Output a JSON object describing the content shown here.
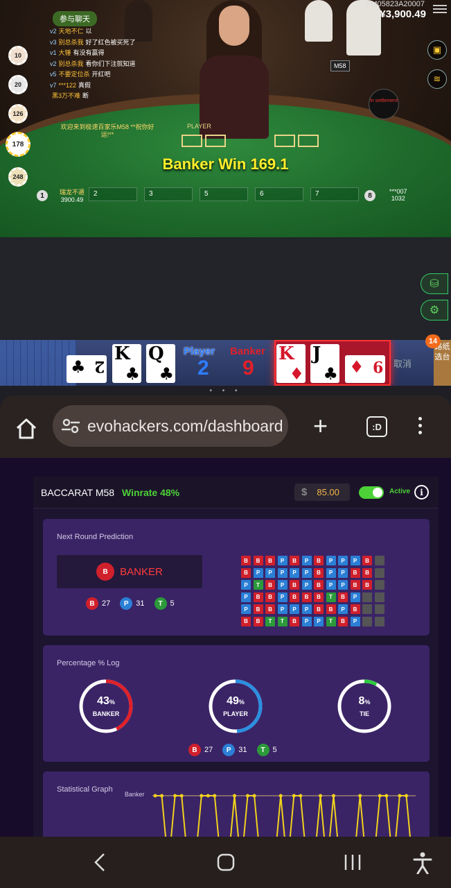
{
  "video": {
    "table_id": "GM05823A20007",
    "balance": "¥3,900.49",
    "chat_tab": "参与聊天",
    "chat": [
      {
        "lvl": "v2",
        "name": "天地不仁",
        "msg": "以"
      },
      {
        "lvl": "v3",
        "name": "别总杀我",
        "msg": "好了红色被买死了"
      },
      {
        "lvl": "v1",
        "name": "大锤",
        "msg": "有没有赢得"
      },
      {
        "lvl": "v2",
        "name": "别总杀我",
        "msg": "看你们下注就知道"
      },
      {
        "lvl": "v5",
        "name": "不要定位杀",
        "msg": "开红吧"
      },
      {
        "lvl": "v7",
        "name": "***122",
        "msg": "真假"
      },
      {
        "lvl": "",
        "name": "黑3万不难",
        "msg": "断"
      }
    ],
    "welcome": "欢迎来到极速百家乐M58 **祝你好运!**",
    "chips": [
      "10",
      "20",
      "126",
      "178",
      "248"
    ],
    "result_banner": "Banker Win 169.1",
    "shoe_label": "M58",
    "settlement": "In settlement",
    "player_label": "PLAYER",
    "seat_left_name": "瑞龙不遁",
    "seat_left_balance": "3900.49",
    "seat_left_num": "1",
    "seat_right_num": "8",
    "seat_right_name": "***007",
    "seat_right_balance": "1032",
    "seat_boxes": [
      "2",
      "3",
      "5",
      "6",
      "7"
    ]
  },
  "cards_strip": {
    "player_cards": [
      {
        "rank": "2",
        "suit": "♣",
        "color": "black",
        "side": true
      },
      {
        "rank": "K",
        "suit": "♣",
        "color": "black",
        "side": false
      },
      {
        "rank": "Q",
        "suit": "♣",
        "color": "black",
        "side": false
      }
    ],
    "banker_cards": [
      {
        "rank": "K",
        "suit": "♦",
        "color": "red",
        "side": false
      },
      {
        "rank": "J",
        "suit": "♣",
        "color": "black",
        "side": false
      },
      {
        "rank": "9",
        "suit": "♦",
        "color": "red",
        "side": true
      }
    ],
    "player_label": "Player",
    "player_score": "2",
    "banker_label": "Banker",
    "banker_score": "9",
    "cancel_text": "取消",
    "road_button": "路纸选台",
    "badge": "14",
    "page_dots": "• • •"
  },
  "browser": {
    "url": "evohackers.com/dashboard",
    "tabs_label": ":D"
  },
  "dashboard": {
    "title": "BACCARAT M58",
    "title_overlap": "M58",
    "winrate": "Winrate 48%",
    "amount": "85.00",
    "currency_symbol": "$",
    "active_label": "Active",
    "info_symbol": "i",
    "prediction": {
      "title": "Next Round Prediction",
      "badge": "B",
      "label": "BANKER",
      "counts": [
        {
          "letter": "B",
          "value": "27",
          "kind": "b"
        },
        {
          "letter": "P",
          "value": "31",
          "kind": "p"
        },
        {
          "letter": "T",
          "value": "5",
          "kind": "t"
        }
      ],
      "grid": [
        [
          "B",
          "B",
          "B",
          "P",
          "B",
          "P",
          "B",
          "P",
          "P",
          "P",
          "B",
          ""
        ],
        [
          "B",
          "P",
          "P",
          "P",
          "P",
          "P",
          "B",
          "P",
          "P",
          "B",
          "B",
          ""
        ],
        [
          "P",
          "T",
          "B",
          "P",
          "B",
          "P",
          "B",
          "P",
          "P",
          "B",
          "B",
          ""
        ],
        [
          "P",
          "B",
          "B",
          "P",
          "B",
          "B",
          "B",
          "T",
          "B",
          "P",
          "",
          ""
        ],
        [
          "P",
          "B",
          "B",
          "P",
          "P",
          "P",
          "B",
          "B",
          "P",
          "B",
          "",
          ""
        ],
        [
          "B",
          "B",
          "T",
          "T",
          "B",
          "P",
          "P",
          "T",
          "B",
          "P",
          "",
          ""
        ]
      ]
    },
    "percentage": {
      "title": "Percentage % Log",
      "gauges": [
        {
          "value": "43",
          "label": "BANKER",
          "fraction": 0.43,
          "color": "#e0202a"
        },
        {
          "value": "49",
          "label": "PLAYER",
          "fraction": 0.49,
          "color": "#2b8fe0"
        },
        {
          "value": "8",
          "label": "TIE",
          "fraction": 0.08,
          "color": "#2ecc40"
        }
      ],
      "percent_sign": "%",
      "counts": [
        {
          "letter": "B",
          "value": "27",
          "kind": "b"
        },
        {
          "letter": "P",
          "value": "31",
          "kind": "p"
        },
        {
          "letter": "T",
          "value": "5",
          "kind": "t"
        }
      ]
    },
    "graph": {
      "title": "Statistical Graph",
      "series_label": "Banker"
    }
  },
  "colors": {
    "banker": "#d0202c",
    "player": "#2b7fd6",
    "tie": "#2c9a3a",
    "accent_green": "#4cd137",
    "panel": "#3a2466"
  }
}
